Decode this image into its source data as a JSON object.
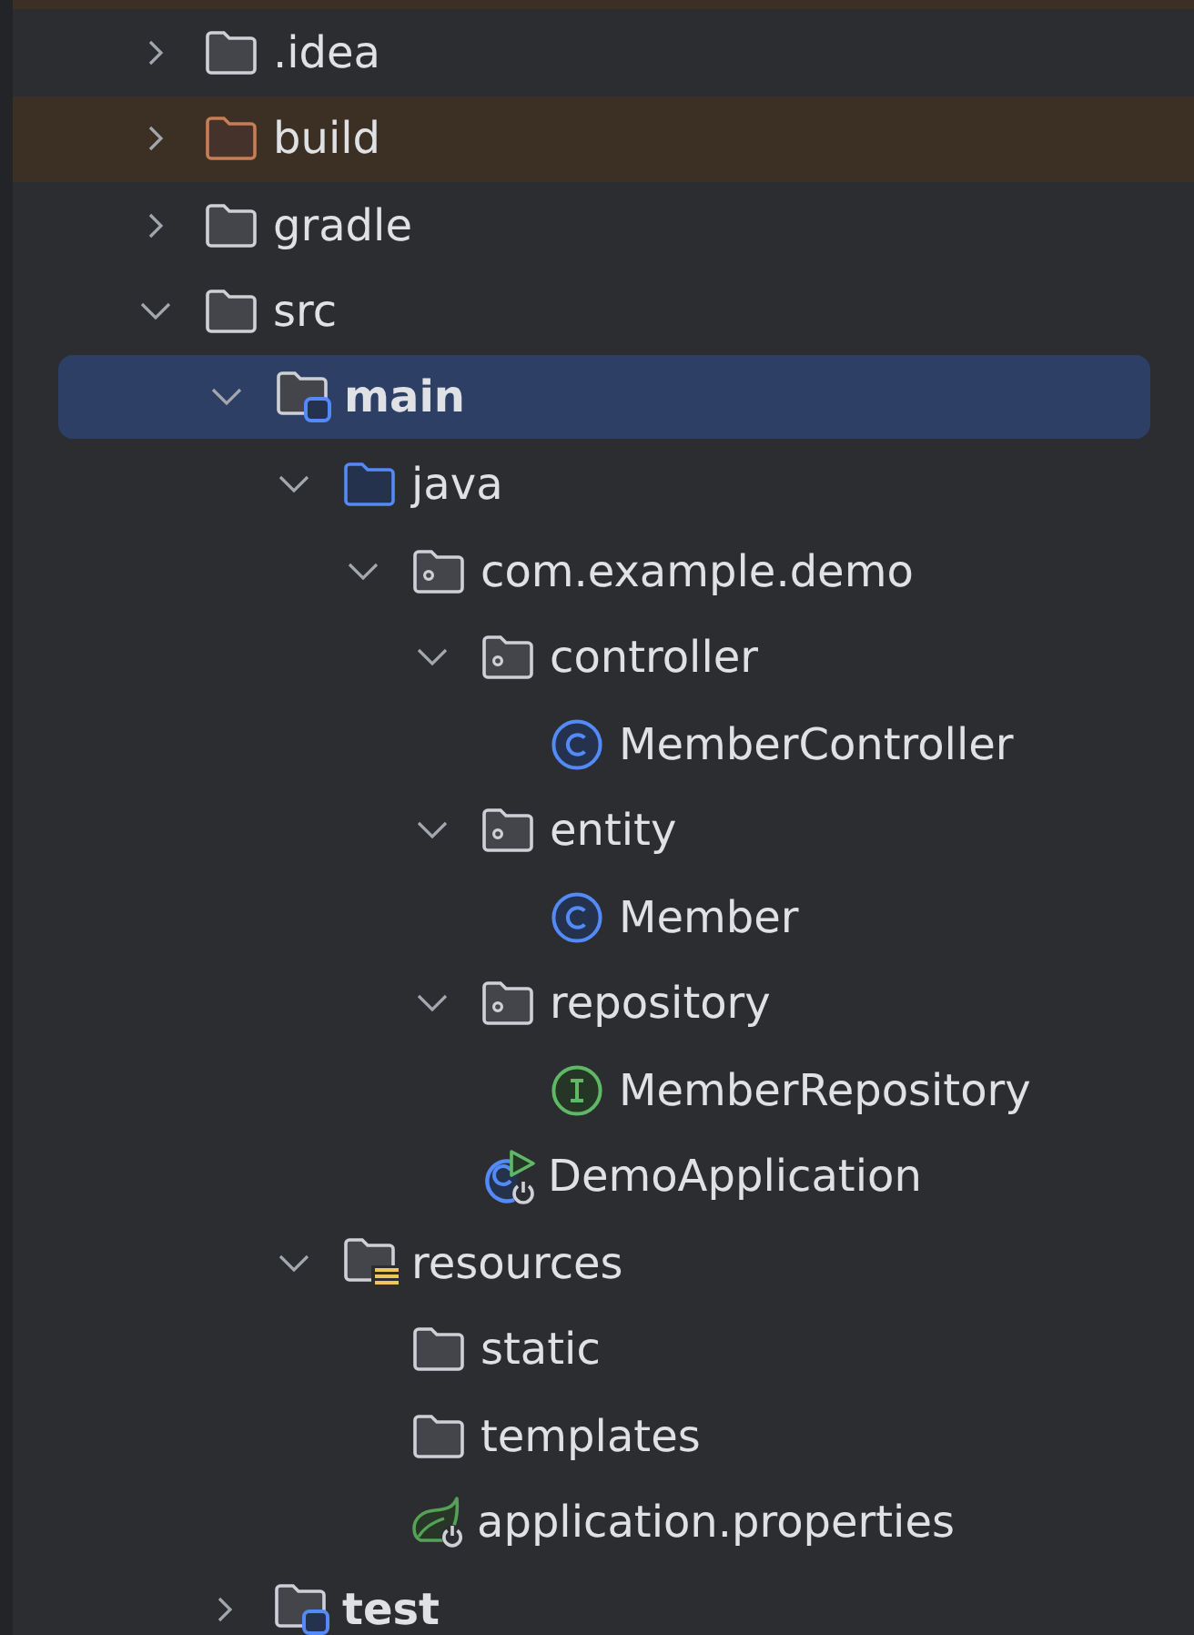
{
  "project_tree": {
    "items": [
      {
        "label": ".idea",
        "kind": "folder",
        "expanded": false,
        "selected": false
      },
      {
        "label": "build",
        "kind": "excluded-folder",
        "expanded": false,
        "selected": false
      },
      {
        "label": "gradle",
        "kind": "folder",
        "expanded": false,
        "selected": false
      },
      {
        "label": "src",
        "kind": "folder",
        "expanded": true,
        "selected": false,
        "children": [
          {
            "label": "main",
            "kind": "module",
            "expanded": true,
            "selected": true,
            "children": [
              {
                "label": "java",
                "kind": "source-folder",
                "expanded": true,
                "selected": false,
                "children": [
                  {
                    "label": "com.example.demo",
                    "kind": "package",
                    "expanded": true,
                    "selected": false,
                    "children": [
                      {
                        "label": "controller",
                        "kind": "package",
                        "expanded": true,
                        "selected": false,
                        "children": [
                          {
                            "label": "MemberController",
                            "kind": "class",
                            "selected": false
                          }
                        ]
                      },
                      {
                        "label": "entity",
                        "kind": "package",
                        "expanded": true,
                        "selected": false,
                        "children": [
                          {
                            "label": "Member",
                            "kind": "class",
                            "selected": false
                          }
                        ]
                      },
                      {
                        "label": "repository",
                        "kind": "package",
                        "expanded": true,
                        "selected": false,
                        "children": [
                          {
                            "label": "MemberRepository",
                            "kind": "interface",
                            "selected": false
                          }
                        ]
                      },
                      {
                        "label": "DemoApplication",
                        "kind": "app-class",
                        "selected": false
                      }
                    ]
                  }
                ]
              },
              {
                "label": "resources",
                "kind": "resources-folder",
                "expanded": true,
                "selected": false,
                "children": [
                  {
                    "label": "static",
                    "kind": "folder",
                    "selected": false
                  },
                  {
                    "label": "templates",
                    "kind": "folder",
                    "selected": false
                  },
                  {
                    "label": "application.properties",
                    "kind": "properties",
                    "selected": false
                  }
                ]
              }
            ]
          },
          {
            "label": "test",
            "kind": "module",
            "expanded": false,
            "selected": false
          }
        ]
      }
    ]
  }
}
